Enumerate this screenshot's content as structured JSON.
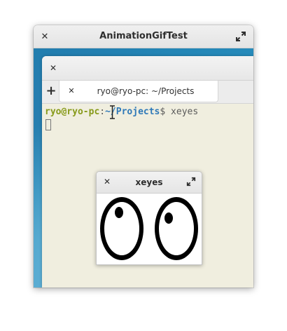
{
  "outer_window": {
    "title": "AnimationGifTest",
    "close_glyph": "✕",
    "icons": [
      "close-icon",
      "maximize-icon"
    ]
  },
  "terminal_window": {
    "close_glyph": "✕",
    "new_tab_glyph": "+",
    "tab_close_glyph": "✕",
    "tab_label": "ryo@ryo-pc: ~/Projects",
    "prompt_user": "ryo@ryo-pc",
    "prompt_sep": ":",
    "prompt_path": "~/Projects",
    "prompt_symbol": "$",
    "command": " xeyes"
  },
  "xeyes_window": {
    "title": "xeyes",
    "close_glyph": "✕",
    "icons": [
      "close-icon",
      "maximize-icon",
      "eye-icon"
    ]
  },
  "colors": {
    "prompt_user": "#879a1a",
    "prompt_path": "#2f79b8",
    "terminal_bg": "#f0eedf",
    "wallpaper": "#2a90bf"
  }
}
